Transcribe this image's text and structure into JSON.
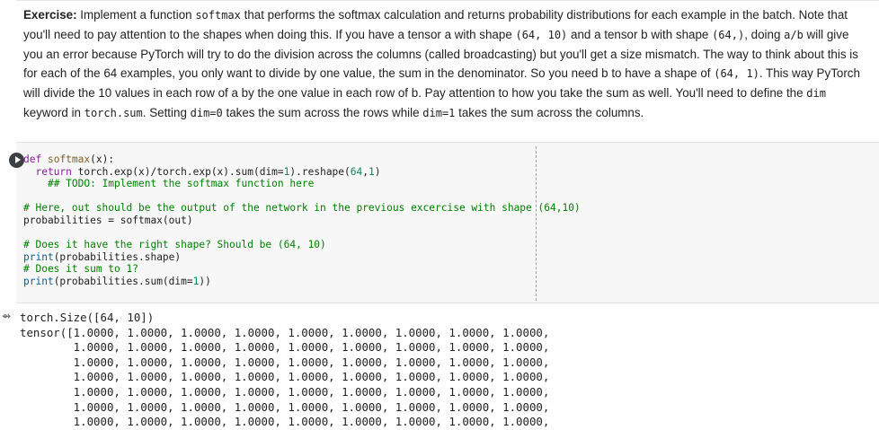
{
  "markdown": {
    "bold_label": "Exercise:",
    "seg1": " Implement a function ",
    "c1": "softmax",
    "seg2": " that performs the softmax calculation and returns probability distributions for each example in the batch. Note that you'll need to pay attention to the shapes when doing this. If you have a tensor ",
    "seg2b": "a with shape ",
    "c2": "(64, 10)",
    "seg3": " and a tensor ",
    "seg3b": "b with shape ",
    "c3": "(64,)",
    "seg4": ", doing ",
    "c4": "a/b",
    "seg5": " will give you an error because PyTorch will try to do the division across the columns (called broadcasting) but you'll get a size mismatch. The way to think about this is for each of the 64 examples, you only want to divide by one value, the sum in the denominator. So you need ",
    "seg5b": "b to have a shape of ",
    "c5": "(64, 1)",
    "seg6": ". This way PyTorch will divide the 10 values in each row of ",
    "seg6b": "a by the one value in each row of ",
    "seg6c": "b. Pay attention to how you take the sum as well. You'll need to define the ",
    "c6": "dim",
    "seg7": " keyword in ",
    "c7": "torch.sum",
    "seg8": ". Setting ",
    "c8": "dim=0",
    "seg9": " takes the sum across the rows while ",
    "c9": "dim=1",
    "seg10": " takes the sum across the columns."
  },
  "code": {
    "l1_kw": "def",
    "l1_fn": "softmax",
    "l1_rest": "(x):",
    "l2_kw": "return",
    "l2_rest": " torch.exp(x)/torch.exp(x).sum(dim=",
    "l2_n1": "1",
    "l2_mid": ").reshape(",
    "l2_n2": "64",
    "l2_comma": ",",
    "l2_n3": "1",
    "l2_end": ")",
    "l3": "## TODO: Implement the softmax function here",
    "l5": "# Here, out should be the output of the network in the previous excercise with shape (64,10)",
    "l6": "probabilities = softmax(out)",
    "l8": "# Does it have the right shape? Should be (64, 10)",
    "l9_fn": "print",
    "l9_rest": "(probabilities.shape)",
    "l10": "# Does it sum to 1?",
    "l11_fn": "print",
    "l11_rest": "(probabilities.sum(dim=",
    "l11_n": "1",
    "l11_end": "))"
  },
  "output": {
    "size_line": "torch.Size([64, 10])",
    "tensor_prefix": "tensor([",
    "row_indent": "        ",
    "row_values": "1.0000, 1.0000, 1.0000, 1.0000, 1.0000, 1.0000, 1.0000, 1.0000, 1.0000,",
    "rows": [
      "tensor([1.0000, 1.0000, 1.0000, 1.0000, 1.0000, 1.0000, 1.0000, 1.0000, 1.0000,",
      "        1.0000, 1.0000, 1.0000, 1.0000, 1.0000, 1.0000, 1.0000, 1.0000, 1.0000,",
      "        1.0000, 1.0000, 1.0000, 1.0000, 1.0000, 1.0000, 1.0000, 1.0000, 1.0000,",
      "        1.0000, 1.0000, 1.0000, 1.0000, 1.0000, 1.0000, 1.0000, 1.0000, 1.0000,",
      "        1.0000, 1.0000, 1.0000, 1.0000, 1.0000, 1.0000, 1.0000, 1.0000, 1.0000,",
      "        1.0000, 1.0000, 1.0000, 1.0000, 1.0000, 1.0000, 1.0000, 1.0000, 1.0000,",
      "        1.0000, 1.0000, 1.0000, 1.0000, 1.0000, 1.0000, 1.0000, 1.0000, 1.0000,"
    ]
  },
  "icons": {
    "run": "play-circle-icon",
    "output": "output-arrow-icon"
  }
}
